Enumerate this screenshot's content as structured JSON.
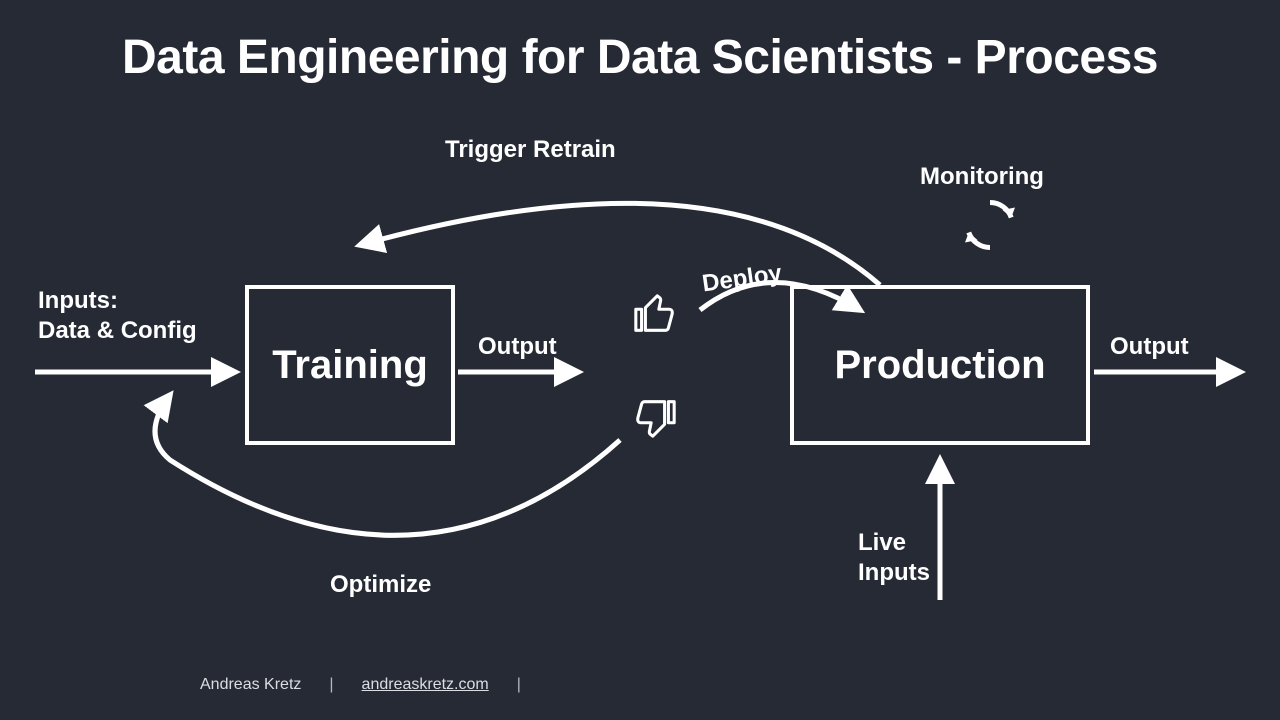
{
  "title": "Data Engineering for Data Scientists - Process",
  "boxes": {
    "training": "Training",
    "production": "Production"
  },
  "labels": {
    "inputs_line1": "Inputs:",
    "inputs_line2": "Data & Config",
    "output_training": "Output",
    "output_production": "Output",
    "deploy": "Deploy",
    "trigger_retrain": "Trigger Retrain",
    "monitoring": "Monitoring",
    "optimize": "Optimize",
    "live_line1": "Live",
    "live_line2": "Inputs"
  },
  "footer": {
    "author": "Andreas Kretz",
    "site": "andreaskretz.com"
  },
  "icons": {
    "thumbs_up": "thumbs-up-icon",
    "thumbs_down": "thumbs-down-icon",
    "cycle": "cycle-arrows-icon"
  }
}
